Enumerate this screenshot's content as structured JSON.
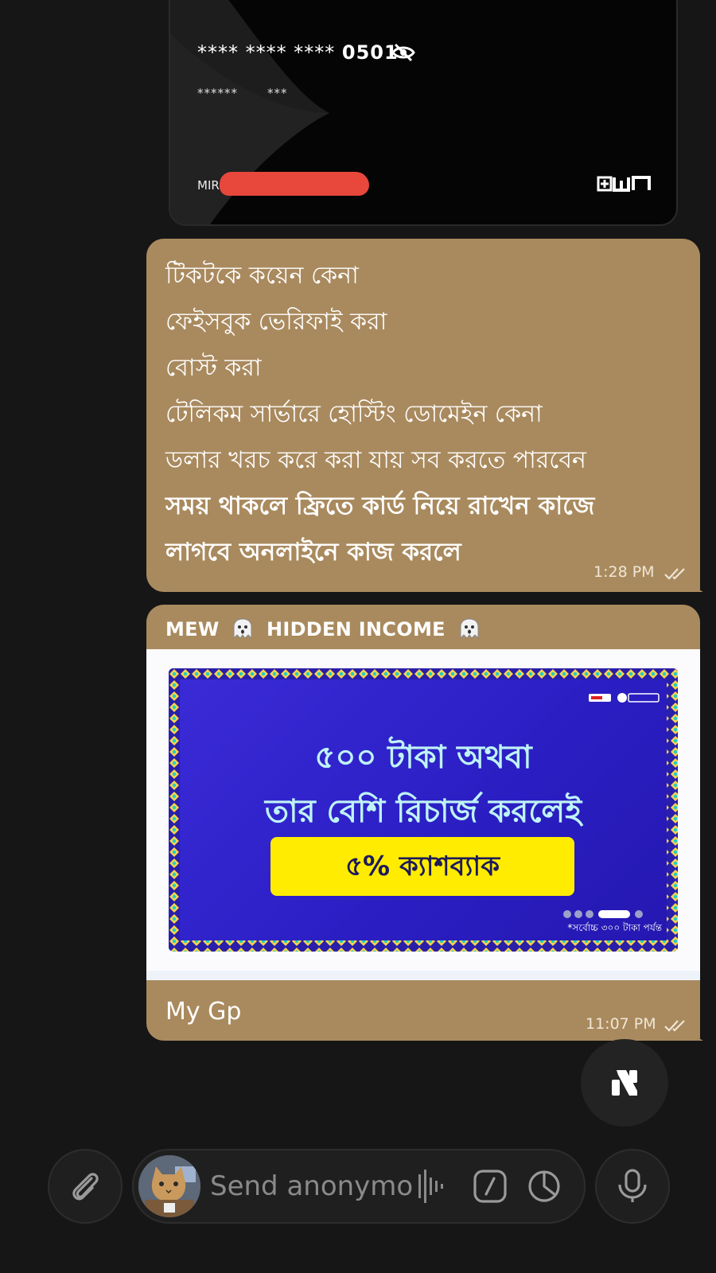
{
  "card": {
    "number_masked": "**** **** **** ",
    "number_last4": "0501",
    "expiry_masked": "******",
    "cvv_masked": "***",
    "holder_prefix": "MIR",
    "brand_icon": "own-logo-icon",
    "eye_icon": "eye-off-icon"
  },
  "text_message": {
    "lines": [
      "টিকটকে কয়েন কেনা",
      "ফেইসবুক ভেরিফাই করা",
      "বোস্ট করা",
      "টেলিকম সার্ভারে হোস্টিং ডোমেইন কেনা",
      "ডলার খরচ করে করা যায় সব করতে পারবেন"
    ],
    "bold_lines": [
      "সময় থাকলে ফ্রিতে কার্ড নিয়ে রাখেন কাজে",
      "লাগবে অনলাইনে কাজ করলে"
    ],
    "time": "1:28 PM",
    "status_icon": "double-check-icon"
  },
  "forwarded_message": {
    "sender_prefix": "MEW",
    "sender_name": "HIDDEN INCOME",
    "ghost_icon": "ghost-emoji-icon",
    "promo": {
      "line1": "৫০০ টাকা অথবা",
      "line2": "তার বেশি রিচার্জ করলেই",
      "button": "৫% ক্যাশব্যাক",
      "note": "*সর্বোচ্চ ৩০০ টাকা পর্যন্ত",
      "brand_colors": {
        "background": "#2b1fc4",
        "button": "#ffec00",
        "text": "#bff3f6"
      }
    },
    "caption": "My Gp",
    "time": "11:07 PM",
    "status_icon": "double-check-icon"
  },
  "composer": {
    "placeholder": "Send anonymo",
    "attach_icon": "paperclip-icon",
    "mic_icon": "microphone-icon",
    "command_icon": "slash-command-icon",
    "timer_icon": "timer-icon",
    "wave_icon": "voice-wave-icon"
  },
  "fab": {
    "icon": "bot-logo-icon"
  },
  "colors": {
    "background": "#161616",
    "bubble": "#a98a5e",
    "redaction": "#e8473c"
  }
}
